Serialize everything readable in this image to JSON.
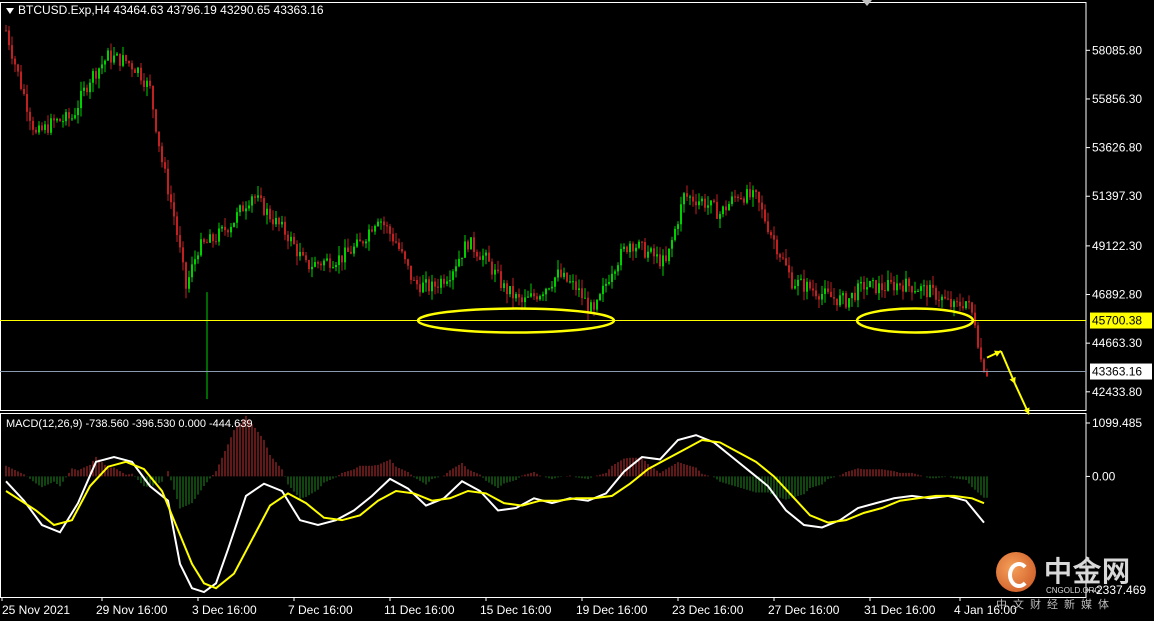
{
  "header": {
    "symbol": "BTCUSD.Exp,H4",
    "ohlc": "43464.63 43796.19 43290.65 43363.16"
  },
  "macd_header": {
    "label": "MACD(12,26,9) -738.560 -396.530 0.000 -444.639"
  },
  "colors": {
    "background": "#000000",
    "bull": "#00d000",
    "bear": "#c02020",
    "grid_border": "#ffffff",
    "level_line": "#ffff00",
    "price_line": "#8a9bb0",
    "macd_main": "#ffffff",
    "macd_signal": "#ffff00",
    "arrow": "#ffff00"
  },
  "chart_data": [
    {
      "type": "candlestick",
      "title": "BTCUSD.Exp,H4",
      "price_axis_ticks": [
        "58085.80",
        "55856.30",
        "53626.80",
        "51397.30",
        "49122.30",
        "46892.80",
        "44663.30",
        "42433.80"
      ],
      "price_tick_values": [
        58085.8,
        55856.3,
        53626.8,
        51397.3,
        49122.3,
        46892.8,
        44663.3,
        42433.8
      ],
      "ylim": [
        41600,
        60300
      ],
      "time_axis_labels": [
        "25 Nov 2021",
        "29 Nov 16:00",
        "3 Dec 16:00",
        "7 Dec 16:00",
        "11 Dec 16:00",
        "15 Dec 16:00",
        "19 Dec 16:00",
        "23 Dec 16:00",
        "27 Dec 16:00",
        "31 Dec 16:00",
        "4 Jan 16:00"
      ],
      "support_level": {
        "value": 45700.38,
        "label": "45700.38"
      },
      "current_price": {
        "value": 43363.16,
        "label": "43363.16"
      },
      "anchors": [
        [
          0,
          59000
        ],
        [
          5,
          56500
        ],
        [
          10,
          54200
        ],
        [
          16,
          54800
        ],
        [
          22,
          55000
        ],
        [
          28,
          56800
        ],
        [
          34,
          57800
        ],
        [
          40,
          57600
        ],
        [
          44,
          57200
        ],
        [
          48,
          56300
        ],
        [
          52,
          53000
        ],
        [
          56,
          50500
        ],
        [
          60,
          47200
        ],
        [
          64,
          49000
        ],
        [
          70,
          49500
        ],
        [
          76,
          50300
        ],
        [
          82,
          51500
        ],
        [
          88,
          50500
        ],
        [
          94,
          49600
        ],
        [
          100,
          48200
        ],
        [
          106,
          48400
        ],
        [
          112,
          48600
        ],
        [
          118,
          49200
        ],
        [
          124,
          50500
        ],
        [
          130,
          49300
        ],
        [
          136,
          47400
        ],
        [
          142,
          47200
        ],
        [
          148,
          47900
        ],
        [
          154,
          49300
        ],
        [
          160,
          48500
        ],
        [
          166,
          47200
        ],
        [
          172,
          46500
        ],
        [
          178,
          47000
        ],
        [
          184,
          47800
        ],
        [
          190,
          47200
        ],
        [
          196,
          46000
        ],
        [
          202,
          48100
        ],
        [
          208,
          49300
        ],
        [
          214,
          48800
        ],
        [
          220,
          48300
        ],
        [
          226,
          51400
        ],
        [
          232,
          51200
        ],
        [
          238,
          50600
        ],
        [
          244,
          51500
        ],
        [
          250,
          51300
        ],
        [
          256,
          49400
        ],
        [
          262,
          47500
        ],
        [
          268,
          47200
        ],
        [
          274,
          46800
        ],
        [
          280,
          46600
        ],
        [
          286,
          47300
        ],
        [
          292,
          47200
        ],
        [
          298,
          47400
        ],
        [
          304,
          47200
        ],
        [
          310,
          46900
        ],
        [
          316,
          46300
        ],
        [
          320,
          46600
        ],
        [
          323,
          45700
        ],
        [
          325,
          43900
        ],
        [
          327,
          43363
        ]
      ],
      "projection_arrows": [
        [
          44000,
          44300
        ],
        [
          44300,
          42800
        ],
        [
          42800,
          41400
        ]
      ]
    },
    {
      "type": "macd",
      "title": "MACD(12,26,9)",
      "values": {
        "main": -738.56,
        "signal": -396.53,
        "zero": 0.0,
        "histogram": -444.639
      },
      "axis_ticks": [
        "1099.485",
        "0.00",
        "-2337.469"
      ],
      "ylim": [
        -2337.469,
        1099.485
      ],
      "main_line": [
        [
          0,
          -100
        ],
        [
          6,
          -500
        ],
        [
          12,
          -1000
        ],
        [
          18,
          -1150
        ],
        [
          24,
          -550
        ],
        [
          30,
          300
        ],
        [
          36,
          400
        ],
        [
          42,
          300
        ],
        [
          48,
          -200
        ],
        [
          54,
          -500
        ],
        [
          58,
          -1800
        ],
        [
          62,
          -2300
        ],
        [
          66,
          -2380
        ],
        [
          70,
          -2200
        ],
        [
          74,
          -1500
        ],
        [
          80,
          -400
        ],
        [
          86,
          -150
        ],
        [
          92,
          -300
        ],
        [
          98,
          -900
        ],
        [
          104,
          -1000
        ],
        [
          110,
          -900
        ],
        [
          116,
          -700
        ],
        [
          122,
          -400
        ],
        [
          128,
          -50
        ],
        [
          134,
          -250
        ],
        [
          140,
          -600
        ],
        [
          146,
          -450
        ],
        [
          152,
          -100
        ],
        [
          158,
          -300
        ],
        [
          164,
          -700
        ],
        [
          170,
          -650
        ],
        [
          176,
          -450
        ],
        [
          182,
          -550
        ],
        [
          188,
          -450
        ],
        [
          194,
          -500
        ],
        [
          200,
          -350
        ],
        [
          206,
          100
        ],
        [
          212,
          400
        ],
        [
          218,
          350
        ],
        [
          224,
          750
        ],
        [
          230,
          850
        ],
        [
          236,
          700
        ],
        [
          242,
          400
        ],
        [
          248,
          100
        ],
        [
          254,
          -200
        ],
        [
          260,
          -700
        ],
        [
          266,
          -1000
        ],
        [
          272,
          -1050
        ],
        [
          278,
          -900
        ],
        [
          284,
          -650
        ],
        [
          290,
          -550
        ],
        [
          296,
          -450
        ],
        [
          302,
          -400
        ],
        [
          308,
          -450
        ],
        [
          314,
          -400
        ],
        [
          320,
          -500
        ],
        [
          326,
          -950
        ]
      ],
      "signal_line": [
        [
          0,
          -300
        ],
        [
          10,
          -700
        ],
        [
          16,
          -1000
        ],
        [
          22,
          -900
        ],
        [
          28,
          -200
        ],
        [
          34,
          200
        ],
        [
          40,
          300
        ],
        [
          46,
          150
        ],
        [
          52,
          -300
        ],
        [
          58,
          -1200
        ],
        [
          62,
          -1800
        ],
        [
          66,
          -2200
        ],
        [
          70,
          -2300
        ],
        [
          76,
          -2000
        ],
        [
          82,
          -1300
        ],
        [
          88,
          -600
        ],
        [
          94,
          -350
        ],
        [
          100,
          -550
        ],
        [
          106,
          -850
        ],
        [
          112,
          -900
        ],
        [
          118,
          -800
        ],
        [
          124,
          -500
        ],
        [
          130,
          -300
        ],
        [
          136,
          -350
        ],
        [
          142,
          -500
        ],
        [
          148,
          -450
        ],
        [
          154,
          -300
        ],
        [
          160,
          -350
        ],
        [
          166,
          -550
        ],
        [
          172,
          -600
        ],
        [
          178,
          -500
        ],
        [
          184,
          -500
        ],
        [
          190,
          -450
        ],
        [
          196,
          -450
        ],
        [
          202,
          -400
        ],
        [
          208,
          -150
        ],
        [
          214,
          150
        ],
        [
          220,
          350
        ],
        [
          226,
          550
        ],
        [
          232,
          750
        ],
        [
          238,
          700
        ],
        [
          244,
          500
        ],
        [
          250,
          300
        ],
        [
          256,
          0
        ],
        [
          262,
          -400
        ],
        [
          268,
          -800
        ],
        [
          274,
          -950
        ],
        [
          280,
          -900
        ],
        [
          286,
          -750
        ],
        [
          292,
          -650
        ],
        [
          298,
          -500
        ],
        [
          304,
          -450
        ],
        [
          310,
          -400
        ],
        [
          316,
          -400
        ],
        [
          322,
          -450
        ],
        [
          326,
          -550
        ]
      ]
    }
  ],
  "watermark": {
    "name": "中金网",
    "domain": "CNGOLD.ORG",
    "slogan": "中文财经新媒体"
  }
}
